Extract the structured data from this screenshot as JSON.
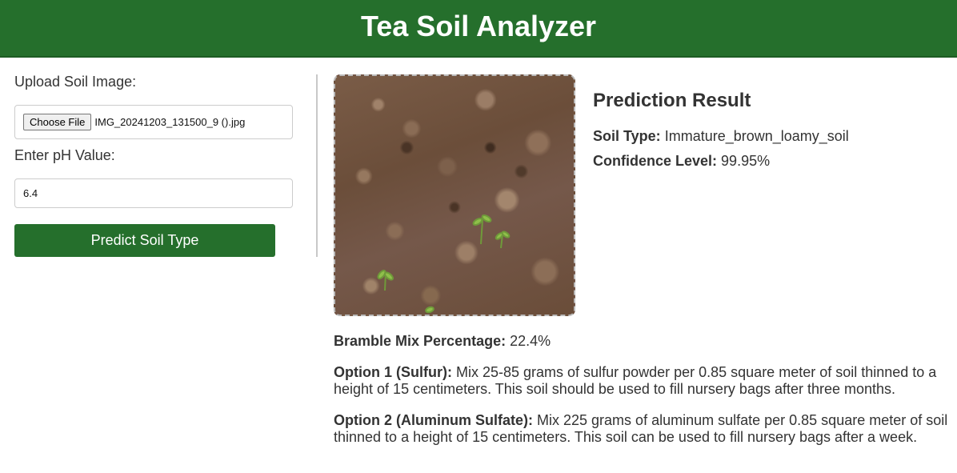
{
  "header": {
    "title": "Tea Soil Analyzer"
  },
  "form": {
    "upload_label": "Upload Soil Image:",
    "file_button": "Choose File",
    "file_name": "IMG_20241203_131500_9 ().jpg",
    "ph_label": "Enter pH Value:",
    "ph_value": "6.4",
    "predict_button": "Predict Soil Type"
  },
  "image": {
    "alt": "Soil sample photo"
  },
  "result": {
    "title": "Prediction Result",
    "soil_type_label": "Soil Type:",
    "soil_type_value": "Immature_brown_loamy_soil",
    "confidence_label": "Confidence Level:",
    "confidence_value": "99.95%",
    "bramble_label": "Bramble Mix Percentage:",
    "bramble_value": "22.4%",
    "option1_label": "Option 1 (Sulfur):",
    "option1_text": "Mix 25-85 grams of sulfur powder per 0.85 square meter of soil thinned to a height of 15 centimeters. This soil should be used to fill nursery bags after three months.",
    "option2_label": "Option 2 (Aluminum Sulfate):",
    "option2_text": "Mix 225 grams of aluminum sulfate per 0.85 square meter of soil thinned to a height of 15 centimeters. This soil can be used to fill nursery bags after a week."
  },
  "colors": {
    "brand_green": "#256f2c",
    "text": "#333333"
  }
}
